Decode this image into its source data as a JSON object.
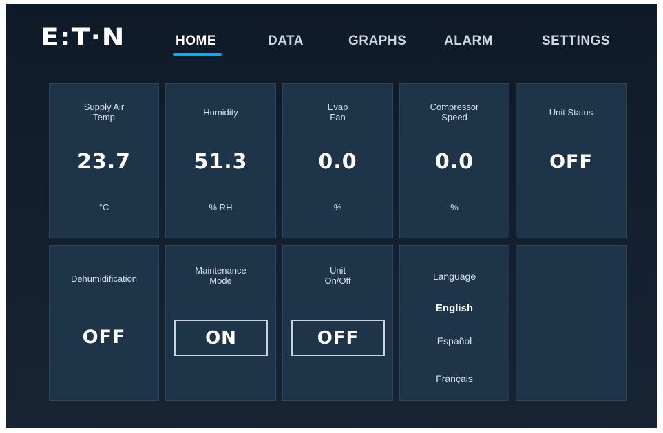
{
  "header": {
    "logo": "E:T·N",
    "nav": [
      {
        "label": "HOME",
        "active": true
      },
      {
        "label": "DATA",
        "active": false
      },
      {
        "label": "GRAPHS",
        "active": false
      },
      {
        "label": "ALARM",
        "active": false
      },
      {
        "label": "SETTINGS",
        "active": false
      }
    ]
  },
  "tiles": {
    "supply_air_temp": {
      "label": "Supply Air\nTemp",
      "value": "23.7",
      "unit": "°C"
    },
    "humidity": {
      "label": "Humidity",
      "value": "51.3",
      "unit": "% RH"
    },
    "evap_fan": {
      "label": "Evap\nFan",
      "value": "0.0",
      "unit": "%"
    },
    "compressor_speed": {
      "label": "Compressor\nSpeed",
      "value": "0.0",
      "unit": "%"
    },
    "unit_status": {
      "label": "Unit Status",
      "value": "OFF"
    },
    "dehumidification": {
      "label": "Dehumidification",
      "value": "OFF"
    },
    "maintenance_mode": {
      "label": "Maintenance\nMode",
      "button": "ON"
    },
    "unit_onoff": {
      "label": "Unit\nOn/Off",
      "button": "OFF"
    },
    "language": {
      "label": "Language",
      "options": [
        "English",
        "Español",
        "Français"
      ],
      "selected": "English"
    }
  },
  "colors": {
    "accent": "#1aa3e8",
    "background": "#14202f",
    "tile": "#1e3549"
  }
}
